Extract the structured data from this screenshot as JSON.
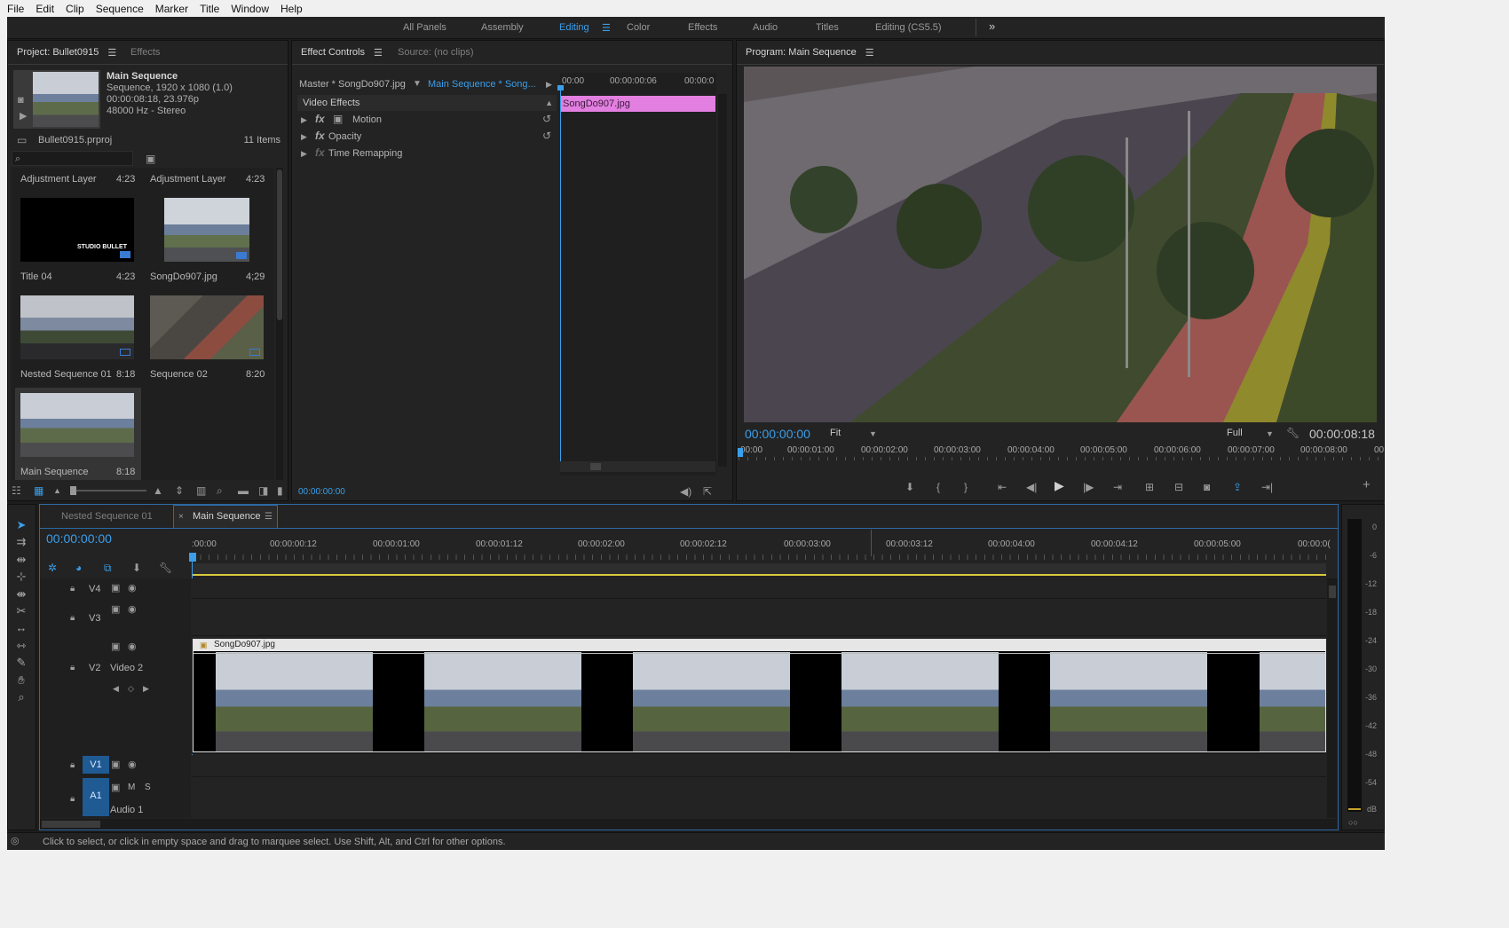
{
  "menu": [
    "File",
    "Edit",
    "Clip",
    "Sequence",
    "Marker",
    "Title",
    "Window",
    "Help"
  ],
  "workspaces": [
    "All Panels",
    "Assembly",
    "Editing",
    "Color",
    "Effects",
    "Audio",
    "Titles",
    "Editing (CS5.5)"
  ],
  "workspace_active": "Editing",
  "workspace_more": "»",
  "project": {
    "tab_label": "Project: Bullet0915",
    "effects_tab": "Effects",
    "preview_name": "Main Sequence",
    "preview_line1": "Sequence, 1920 x 1080 (1.0)",
    "preview_line2": "00:00:08:18, 23.976p",
    "preview_line3": "48000 Hz - Stereo",
    "file_name": "Bullet0915.prproj",
    "item_count": "11 Items",
    "items": [
      {
        "name": "Adjustment Layer",
        "dur": "4:23"
      },
      {
        "name": "Adjustment Layer",
        "dur": "4:23"
      },
      {
        "name": "Title 04",
        "dur": "4:23",
        "overlay": "STUDIO BULLET"
      },
      {
        "name": "SongDo907.jpg",
        "dur": "4;29"
      },
      {
        "name": "Nested Sequence 01",
        "dur": "8:18"
      },
      {
        "name": "Sequence 02",
        "dur": "8:20"
      },
      {
        "name": "Main Sequence",
        "dur": "8:18"
      }
    ]
  },
  "effect_controls": {
    "tab_label": "Effect Controls",
    "source_tab": "Source: (no clips)",
    "master": "Master * SongDo907.jpg",
    "sequence_clip": "Main Sequence * Song...",
    "section": "Video Effects",
    "effects": [
      "Motion",
      "Opacity",
      "Time Remapping"
    ],
    "ruler": [
      "00:00",
      "00:00:00:06",
      "00:00:0"
    ],
    "clip_name": "SongDo907.jpg",
    "timecode": "00:00:00:00"
  },
  "program": {
    "tab_label": "Program: Main Sequence",
    "timecode": "00:00:00:00",
    "fit": "Fit",
    "quality": "Full",
    "duration": "00:00:08:18",
    "ruler": [
      "00:00",
      "00:00:01:00",
      "00:00:02:00",
      "00:00:03:00",
      "00:00:04:00",
      "00:00:05:00",
      "00:00:06:00",
      "00:00:07:00",
      "00:00:08:00",
      "00"
    ]
  },
  "timeline": {
    "tabs": [
      "Nested Sequence 01",
      "Main Sequence"
    ],
    "active_tab": "Main Sequence",
    "timecode": "00:00:00:00",
    "ruler": [
      ":00:00",
      "00:00:00:12",
      "00:00:01:00",
      "00:00:01:12",
      "00:00:02:00",
      "00:00:02:12",
      "00:00:03:00",
      "00:00:03:12",
      "00:00:04:00",
      "00:00:04:12",
      "00:00:05:00",
      "00:00:0("
    ],
    "tracks": {
      "v4": "V4",
      "v3": "V3",
      "v2": "V2",
      "v2_name": "Video 2",
      "v1": "V1",
      "a1": "A1",
      "a1_name": "Audio 1",
      "mute": "M",
      "solo": "S"
    },
    "clip_name": "SongDo907.jpg"
  },
  "meter_ticks": [
    "0",
    "-6",
    "-12",
    "-18",
    "-24",
    "-30",
    "-36",
    "-42",
    "-48",
    "-54",
    "dB"
  ],
  "status_text": "Click to select, or click in empty space and drag to marquee select. Use Shift, Alt, and Ctrl for other options."
}
